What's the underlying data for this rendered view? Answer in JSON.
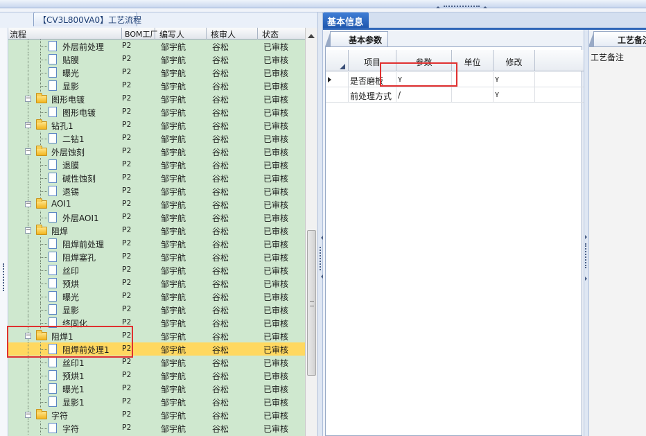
{
  "left_panel": {
    "title": "【CV3L800VA0】工艺流程",
    "columns": [
      "流程",
      "BOM工厂",
      "编写人",
      "核审人",
      "状态"
    ],
    "rows": [
      {
        "name": "外层前处理",
        "bom": "P2",
        "writer": "邹宇航",
        "reviewer": "谷松",
        "status": "已审核"
      },
      {
        "name": "贴膜",
        "bom": "P2",
        "writer": "邹宇航",
        "reviewer": "谷松",
        "status": "已审核"
      },
      {
        "name": "曝光",
        "bom": "P2",
        "writer": "邹宇航",
        "reviewer": "谷松",
        "status": "已审核"
      },
      {
        "name": "显影",
        "bom": "P2",
        "writer": "邹宇航",
        "reviewer": "谷松",
        "status": "已审核"
      },
      {
        "name": "图形电镀",
        "bom": "P2",
        "writer": "邹宇航",
        "reviewer": "谷松",
        "status": "已审核"
      },
      {
        "name": "图形电镀",
        "bom": "P2",
        "writer": "邹宇航",
        "reviewer": "谷松",
        "status": "已审核"
      },
      {
        "name": "钻孔1",
        "bom": "P2",
        "writer": "邹宇航",
        "reviewer": "谷松",
        "status": "已审核"
      },
      {
        "name": "二钻1",
        "bom": "P2",
        "writer": "邹宇航",
        "reviewer": "谷松",
        "status": "已审核"
      },
      {
        "name": "外层蚀刻",
        "bom": "P2",
        "writer": "邹宇航",
        "reviewer": "谷松",
        "status": "已审核"
      },
      {
        "name": "退膜",
        "bom": "P2",
        "writer": "邹宇航",
        "reviewer": "谷松",
        "status": "已审核"
      },
      {
        "name": "碱性蚀刻",
        "bom": "P2",
        "writer": "邹宇航",
        "reviewer": "谷松",
        "status": "已审核"
      },
      {
        "name": "退锡",
        "bom": "P2",
        "writer": "邹宇航",
        "reviewer": "谷松",
        "status": "已审核"
      },
      {
        "name": "AOI1",
        "bom": "P2",
        "writer": "邹宇航",
        "reviewer": "谷松",
        "status": "已审核"
      },
      {
        "name": "外层AOI1",
        "bom": "P2",
        "writer": "邹宇航",
        "reviewer": "谷松",
        "status": "已审核"
      },
      {
        "name": "阻焊",
        "bom": "P2",
        "writer": "邹宇航",
        "reviewer": "谷松",
        "status": "已审核"
      },
      {
        "name": "阻焊前处理",
        "bom": "P2",
        "writer": "邹宇航",
        "reviewer": "谷松",
        "status": "已审核"
      },
      {
        "name": "阻焊塞孔",
        "bom": "P2",
        "writer": "邹宇航",
        "reviewer": "谷松",
        "status": "已审核"
      },
      {
        "name": "丝印",
        "bom": "P2",
        "writer": "邹宇航",
        "reviewer": "谷松",
        "status": "已审核"
      },
      {
        "name": "预烘",
        "bom": "P2",
        "writer": "邹宇航",
        "reviewer": "谷松",
        "status": "已审核"
      },
      {
        "name": "曝光",
        "bom": "P2",
        "writer": "邹宇航",
        "reviewer": "谷松",
        "status": "已审核"
      },
      {
        "name": "显影",
        "bom": "P2",
        "writer": "邹宇航",
        "reviewer": "谷松",
        "status": "已审核"
      },
      {
        "name": "终固化",
        "bom": "P2",
        "writer": "邹宇航",
        "reviewer": "谷松",
        "status": "已审核"
      },
      {
        "name": "阻焊1",
        "bom": "P2",
        "writer": "邹宇航",
        "reviewer": "谷松",
        "status": "已审核"
      },
      {
        "name": "阻焊前处理1",
        "bom": "P2",
        "writer": "邹宇航",
        "reviewer": "谷松",
        "status": "已审核"
      },
      {
        "name": "丝印1",
        "bom": "P2",
        "writer": "邹宇航",
        "reviewer": "谷松",
        "status": "已审核"
      },
      {
        "name": "预烘1",
        "bom": "P2",
        "writer": "邹宇航",
        "reviewer": "谷松",
        "status": "已审核"
      },
      {
        "name": "曝光1",
        "bom": "P2",
        "writer": "邹宇航",
        "reviewer": "谷松",
        "status": "已审核"
      },
      {
        "name": "显影1",
        "bom": "P2",
        "writer": "邹宇航",
        "reviewer": "谷松",
        "status": "已审核"
      },
      {
        "name": "字符",
        "bom": "P2",
        "writer": "邹宇航",
        "reviewer": "谷松",
        "status": "已审核"
      },
      {
        "name": "字符",
        "bom": "P2",
        "writer": "邹宇航",
        "reviewer": "谷松",
        "status": "已审核"
      }
    ]
  },
  "main_tab": "基本信息",
  "params": {
    "tab": "基本参数",
    "columns": [
      "项目",
      "参数",
      "单位",
      "修改"
    ],
    "rows": [
      {
        "item": "是否磨板",
        "value": "Y",
        "unit": "",
        "modify": "Y"
      },
      {
        "item": "前处理方式",
        "value": "/",
        "unit": "",
        "modify": "Y"
      }
    ]
  },
  "notes": {
    "tab": "工艺备注",
    "label": "工艺备注"
  },
  "colors": {
    "tree_bg": "#cfe8cf",
    "selected_row": "#ffd860",
    "tab_blue": "#2f66b8",
    "highlight_box": "#e03030"
  }
}
